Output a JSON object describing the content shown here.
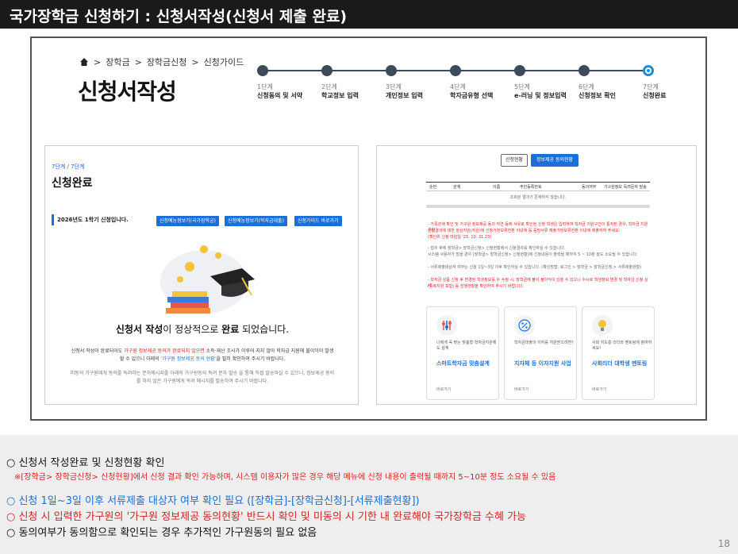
{
  "title": "국가장학금 신청하기 : 신청서작성(신청서 제출 완료)",
  "breadcrumb": [
    "장학금",
    "장학금신청",
    "신청가이드"
  ],
  "page_heading": "신청서작성",
  "steps": [
    {
      "num": "1단계",
      "name": "신청동의 및 서약"
    },
    {
      "num": "2단계",
      "name": "학교정보 입력"
    },
    {
      "num": "3단계",
      "name": "개인정보 입력"
    },
    {
      "num": "4단계",
      "name": "학자금유형 선택"
    },
    {
      "num": "5단계",
      "name": "e-러닝 및 정보입력"
    },
    {
      "num": "6단계",
      "name": "신청정보 확인"
    },
    {
      "num": "7단계",
      "name": "신청완료"
    }
  ],
  "left_panel": {
    "step_label": "7단계 / 7단계",
    "title": "신청완료",
    "info_bar": "2026년도 1학기 신청입니다.",
    "buttons": [
      "신청예능정보기(국가장학금)",
      "신청예능정보기(학자금대출)",
      "신청가이드 바로가기"
    ],
    "done_prefix": "신청서 작성",
    "done_mid": "이 정상적으로",
    "done_bold": "완료",
    "done_suffix": " 되었습니다.",
    "desc_a": "신청서 작성이 완료되어도 ",
    "desc_red": "가구원 정보제공 동의가 완료되지 않으면",
    "desc_b": " 소득·재산 조사가 이루어 지지 않아 학자금 지원에 불이익이 발생할 수 있으니 아래의 ",
    "desc_blue": "'가구원 정보제공 동의 현황'",
    "desc_c": "을 필히 확인하여 주시기 바랍니다.",
    "note": "미동의 가구원에게 동의를 독려하는 문자메시지를 아래의 가구원동의 독려 문자 발송 을 통해 직접 발송하실 수 있으니, 정보제공 동의를 하지 않은 가구원에게 독려 메시지를 발송하여 주시기 바랍니다."
  },
  "right_panel": {
    "tab_status": "신청현황",
    "tab_consent": "정보제공 동의현황",
    "table_headers": [
      "순번",
      "관계",
      "이름",
      "주민등록번호",
      "동의여부",
      "가구원정보 독려문자 발송"
    ],
    "empty_text": "조회된 결과가 존재하지 않습니다.",
    "text_lines": [
      "- 가족관계 확인 및 가구원 정보제공 동의 자연 등에 사유로 확인된 신청 학생은 입력하여 학자금 지원구간이 통지된 경우, 학자금 지원구간",
      "산정결과에 대한 정상지원(지원)에 신청가판보류전환 이내에 등 증빙서류 제출가판보류전환 이내에 제출하여 주세요.",
      "(확인위 신청 마감일 '25. 10. 31.23)",
      "- 접수 후에 장학금> 장학금신청> 신청현황에서 신청결과를 확인하실 수 있습니다.",
      "시스템 사용자가 많을 경우 [장학금> 장학금신청> 신청현황]에 신청내용이 출력될 때까지 5 ~ 10분 정도 소요될 수 있습니다.",
      "- 서류제출대상자 여부는 신청 1일~3일 이후 확인하실 수 있습니다. (확인방법: 로그인 > 장학금 > 장학금신청 > 서류제출현황)",
      "- 학자금 상품 신청 후 변경된 학생정보를 수 수정 시, 장학금에 불이 불이익이 있을 수 있으니 수시로 학생정보 변경 및 학자금 신청 상시",
      "(중복지원 포함) 등 진행현황을 확인하여 주시기 바랍니다."
    ],
    "cards": [
      {
        "icon": "sliders-icon",
        "sub": "나에게 꼭 맞는 맞춤형 학자금지원제도 설계",
        "title": "스마트학자금 맞춤설계",
        "link": "바로가기"
      },
      {
        "icon": "percent-icon",
        "sub": "학자금대출의 이자를 지원받으려면?",
        "title": "지자체 등 이자지원 사업",
        "link": "바로가기"
      },
      {
        "icon": "lightbulb-icon",
        "sub": "사회 지도층 리더와 멘토링에 참여하세요!",
        "title": "사회리더 대학생 멘토링",
        "link": "바로가기"
      }
    ]
  },
  "notes": {
    "line1": "○ 신청서 작성완료 및 신청현황 확인",
    "line1_sub": "※[장학금> 장학금신청> 신청현황]에서 신청 결과 확인 가능하며, 시스템 이용자가 많은 경우 해당 메뉴에 신청 내용이 출력될 때까지 5~10분 정도 소요될 수 있음",
    "line2": "○ 신청 1일~3일 이후 서류제출 대상자 여부 확인 필요 ([장학금]-[장학금신청]-[서류제출현황])",
    "line3": "○ 신청 시 입력한 가구원의 '가구원 정보제공 동의현황' 반드시 확인 및 미동의 시 기한 내 완료해야 국가장학금 수혜 가능",
    "line4": "○ 동의여부가 동의함으로 확인되는 경우 추가적인 가구원동의 필요 없음"
  },
  "page_number": "18"
}
